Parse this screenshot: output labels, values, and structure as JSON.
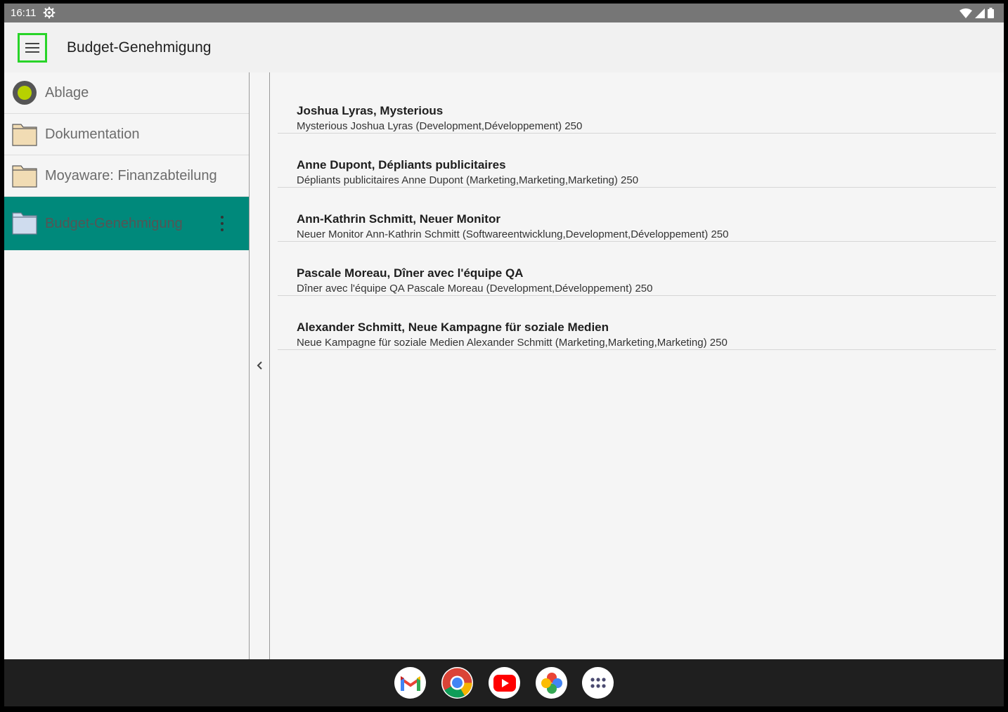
{
  "status_bar": {
    "time": "16:11"
  },
  "app_bar": {
    "title": "Budget-Genehmigung"
  },
  "sidebar": {
    "items": [
      {
        "label": "Ablage",
        "icon": "status-dot-icon"
      },
      {
        "label": "Dokumentation",
        "icon": "folder-icon"
      },
      {
        "label": "Moyaware: Finanzabteilung",
        "icon": "folder-icon"
      },
      {
        "label": "Budget-Genehmigung",
        "icon": "folder-open-icon",
        "selected": true
      }
    ]
  },
  "entries": [
    {
      "title": "Joshua Lyras, Mysterious",
      "subtitle": "Mysterious Joshua Lyras (Development,Développement) 250"
    },
    {
      "title": "Anne Dupont, Dépliants publicitaires",
      "subtitle": "Dépliants publicitaires Anne Dupont (Marketing,Marketing,Marketing) 250"
    },
    {
      "title": "Ann-Kathrin Schmitt, Neuer Monitor",
      "subtitle": "Neuer Monitor Ann-Kathrin Schmitt (Softwareentwicklung,Development,Développement) 250"
    },
    {
      "title": "Pascale Moreau, Dîner avec l'équipe QA",
      "subtitle": "Dîner avec l'équipe QA Pascale Moreau (Development,Développement) 250"
    },
    {
      "title": "Alexander Schmitt, Neue Kampagne für soziale Medien",
      "subtitle": "Neue Kampagne für soziale Medien Alexander Schmitt (Marketing,Marketing,Marketing) 250"
    }
  ],
  "dock": {
    "apps": [
      "gmail-icon",
      "chrome-icon",
      "youtube-icon",
      "photos-icon",
      "app-drawer-icon"
    ]
  },
  "colors": {
    "selected_bg": "#00897b",
    "status_bar": "#767676",
    "dock": "#1f1f1f",
    "highlight_border": "#28d428"
  }
}
